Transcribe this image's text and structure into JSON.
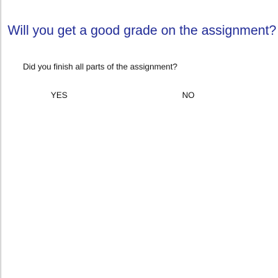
{
  "page": {
    "title": "Will you get a good grade on the assignment?",
    "question": "Did you finish all parts of the assignment?",
    "options": [
      {
        "label": "YES"
      },
      {
        "label": "NO"
      }
    ]
  },
  "colors": {
    "title": "#1f2a96",
    "text": "#111111",
    "background": "#ffffff",
    "left_border": "#d8d8d8"
  }
}
